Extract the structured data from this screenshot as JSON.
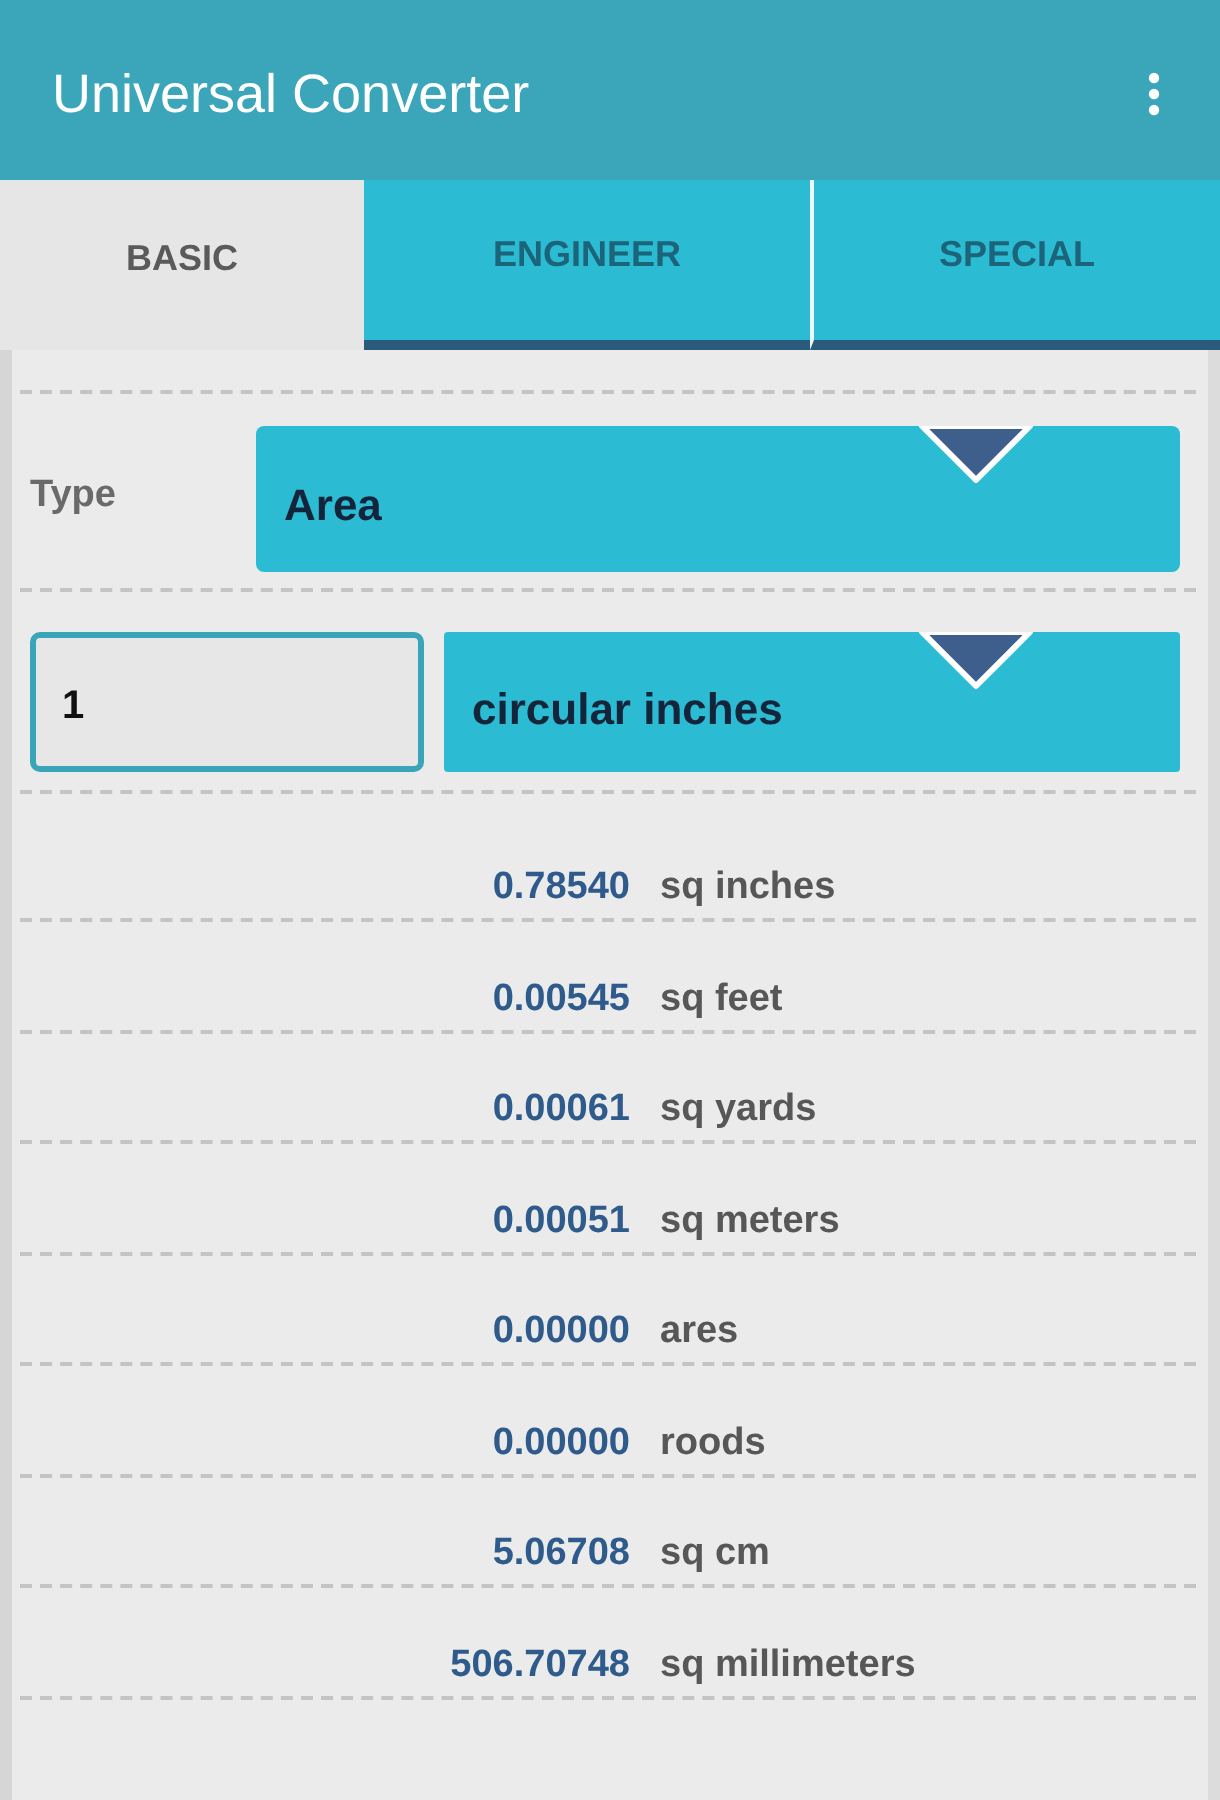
{
  "app_bar": {
    "title": "Universal Converter"
  },
  "tabs": [
    {
      "label": "BASIC",
      "selected": true
    },
    {
      "label": "ENGINEER",
      "selected": false
    },
    {
      "label": "SPECIAL",
      "selected": false
    }
  ],
  "type_row": {
    "label": "Type",
    "value": "Area"
  },
  "input_row": {
    "value": "1",
    "unit": "circular inches"
  },
  "results": [
    {
      "value": "0.78540",
      "unit": "sq inches"
    },
    {
      "value": "0.00545",
      "unit": "sq feet"
    },
    {
      "value": "0.00061",
      "unit": "sq yards"
    },
    {
      "value": "0.00051",
      "unit": "sq meters"
    },
    {
      "value": "0.00000",
      "unit": "ares"
    },
    {
      "value": "0.00000",
      "unit": "roods"
    },
    {
      "value": "5.06708",
      "unit": "sq cm"
    },
    {
      "value": "506.70748",
      "unit": "sq millimeters"
    }
  ]
}
